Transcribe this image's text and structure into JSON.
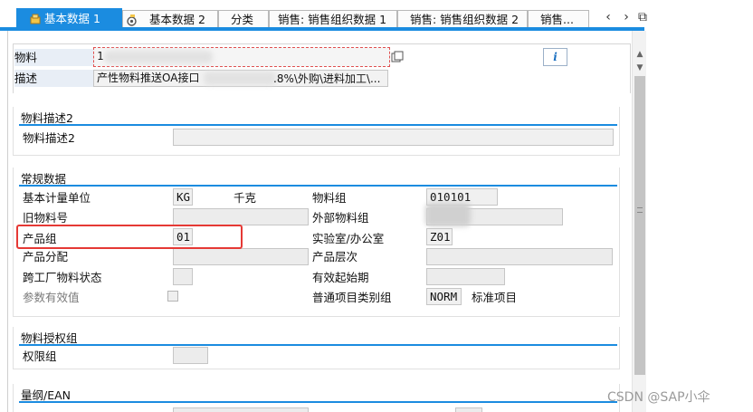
{
  "tabs": [
    {
      "label": "基本数据 1",
      "active": true
    },
    {
      "label": "基本数据 2",
      "active": false
    },
    {
      "label": "分类",
      "active": false
    },
    {
      "label": "销售: 销售组织数据 1",
      "active": false
    },
    {
      "label": "销售: 销售组织数据 2",
      "active": false
    },
    {
      "label": "销售...",
      "active": false
    }
  ],
  "tab_nav": {
    "prev": "‹",
    "next": "›",
    "menu": "⧉"
  },
  "header": {
    "material_label": "物料",
    "material_value": "1",
    "description_label": "描述",
    "description_value": "产性物料推送OA接口",
    "description_tail": ".8%\\外购\\进料加工\\...",
    "info_icon_text": "i"
  },
  "sections": {
    "desc2": {
      "title": "物料描述2",
      "label": "物料描述2",
      "value": ""
    },
    "general": {
      "title": "常规数据",
      "base_uom_label": "基本计量单位",
      "base_uom_value": "KG",
      "base_uom_text": "千克",
      "material_group_label": "物料组",
      "material_group_value": "010101",
      "old_material_label": "旧物料号",
      "old_material_value": "",
      "ext_material_group_label": "外部物料组",
      "ext_material_group_value": "",
      "division_label": "产品组",
      "division_value": "01",
      "lab_office_label": "实验室/办公室",
      "lab_office_value": "Z01",
      "product_alloc_label": "产品分配",
      "product_alloc_value": "",
      "product_hierarchy_label": "产品层次",
      "product_hierarchy_value": "",
      "cross_plant_status_label": "跨工厂物料状态",
      "cross_plant_status_value": "",
      "valid_from_label": "有效起始期",
      "valid_from_value": "",
      "param_effective_label": "参数有效值",
      "item_cat_group_label": "普通项目类别组",
      "item_cat_group_value": "NORM",
      "item_cat_group_text": "标准项目"
    },
    "auth": {
      "title": "物料授权组",
      "auth_group_label": "权限组",
      "auth_group_value": ""
    },
    "dims": {
      "title": "量纲/EAN"
    }
  },
  "watermark": "CSDN @SAP小伞",
  "colors": {
    "accent": "#1b8ce0",
    "highlight_box": "#e53935"
  }
}
